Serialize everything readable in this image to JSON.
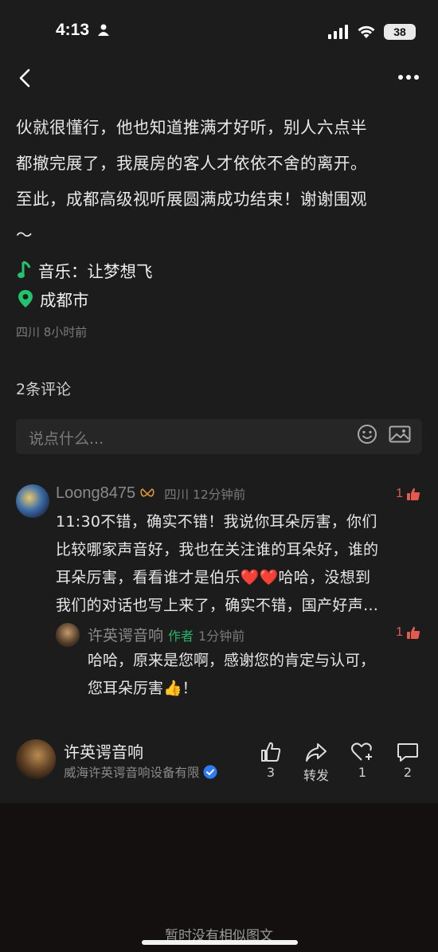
{
  "status": {
    "time": "4:13",
    "battery": "38"
  },
  "post": {
    "body_lines": [
      "伙就很懂行，他也知道推满才好听，别人六点半",
      "都撤完展了，我展房的客人才依依不舍的离开。",
      "至此，成都高级视听展圆满成功结束！谢谢围观",
      "～"
    ],
    "music_label": "音乐：让梦想飞",
    "location": "成都市",
    "meta": "四川 8小时前"
  },
  "comments_header": {
    "count_label": "2条评论",
    "placeholder": "说点什么..."
  },
  "comment": {
    "user": "Loong8475",
    "location_time": "四川 12分钟前",
    "likes": "1",
    "lines": [
      "11:30不错，确实不错！我说你耳朵厉害，你们",
      "比较哪家声音好，我也在关注谁的耳朵好，谁的",
      "耳朵厉害，看看谁才是伯乐❤️❤️哈哈，没想到",
      "我们的对话也写上来了，确实不错，国产好声…"
    ]
  },
  "reply": {
    "user": "许英谔音响",
    "badge": "作者",
    "time": "1分钟前",
    "likes": "1",
    "lines": [
      "哈哈，原来是您啊，感谢您的肯定与认可，",
      "您耳朵厉害👍！"
    ]
  },
  "footer": {
    "author": "许英谔音响",
    "company": "威海许英谔音响设备有限",
    "actions": {
      "like": "3",
      "share": "转发",
      "collect": "1",
      "comment": "2"
    }
  },
  "bottom": {
    "no_similar": "暂时没有相似图文"
  },
  "colors": {
    "bg": "#1c1c1c",
    "accent_green": "#26b36a",
    "like_red": "#e25b4f",
    "verified_blue": "#2f7bf5"
  }
}
